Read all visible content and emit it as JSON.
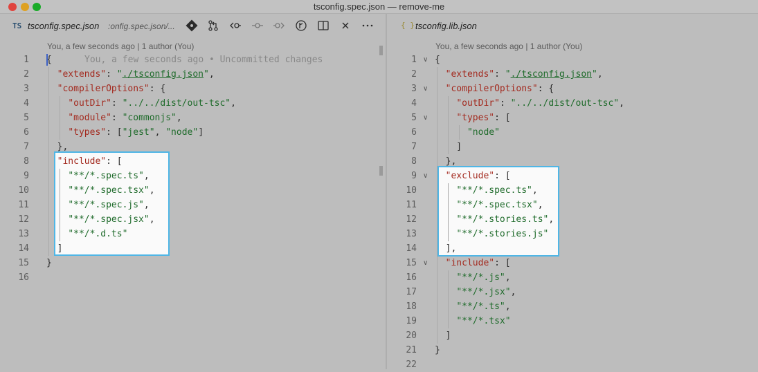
{
  "window": {
    "title": "tsconfig.spec.json — remove-me"
  },
  "left_editor": {
    "tab": {
      "icon_label": "TS",
      "filename": "tsconfig.spec.json",
      "path": ":onfig.spec.json/..."
    },
    "toolbar_icons": [
      "git-commit-icon",
      "pull-request-icon",
      "go-back-icon",
      "commit-node-icon",
      "go-forward-icon",
      "compass-icon",
      "split-editor-icon",
      "close-icon",
      "more-icon"
    ],
    "blame": "You, a few seconds ago | 1 author (You)",
    "inline_blame": "You, a few seconds ago • Uncommitted changes",
    "lines": [
      {
        "n": "1",
        "t": "{"
      },
      {
        "n": "2",
        "t": "  \"extends\": \"./tsconfig.json\","
      },
      {
        "n": "3",
        "t": "  \"compilerOptions\": {"
      },
      {
        "n": "4",
        "t": "    \"outDir\": \"../../dist/out-tsc\","
      },
      {
        "n": "5",
        "t": "    \"module\": \"commonjs\","
      },
      {
        "n": "6",
        "t": "    \"types\": [\"jest\", \"node\"]"
      },
      {
        "n": "7",
        "t": "  },"
      },
      {
        "n": "8",
        "t": "  \"include\": ["
      },
      {
        "n": "9",
        "t": "    \"**/*.spec.ts\","
      },
      {
        "n": "10",
        "t": "    \"**/*.spec.tsx\","
      },
      {
        "n": "11",
        "t": "    \"**/*.spec.js\","
      },
      {
        "n": "12",
        "t": "    \"**/*.spec.jsx\","
      },
      {
        "n": "13",
        "t": "    \"**/*.d.ts\""
      },
      {
        "n": "14",
        "t": "  ]"
      },
      {
        "n": "15",
        "t": "}"
      },
      {
        "n": "16",
        "t": ""
      }
    ]
  },
  "right_editor": {
    "tab": {
      "icon_label": "{ }",
      "filename": "tsconfig.lib.json"
    },
    "blame": "You, a few seconds ago | 1 author (You)",
    "lines": [
      {
        "n": "1",
        "t": "{"
      },
      {
        "n": "2",
        "t": "  \"extends\": \"./tsconfig.json\","
      },
      {
        "n": "3",
        "t": "  \"compilerOptions\": {"
      },
      {
        "n": "4",
        "t": "    \"outDir\": \"../../dist/out-tsc\","
      },
      {
        "n": "5",
        "t": "    \"types\": ["
      },
      {
        "n": "6",
        "t": "      \"node\""
      },
      {
        "n": "7",
        "t": "    ]"
      },
      {
        "n": "8",
        "t": "  },"
      },
      {
        "n": "9",
        "t": "  \"exclude\": ["
      },
      {
        "n": "10",
        "t": "    \"**/*.spec.ts\","
      },
      {
        "n": "11",
        "t": "    \"**/*.spec.tsx\","
      },
      {
        "n": "12",
        "t": "    \"**/*.stories.ts\","
      },
      {
        "n": "13",
        "t": "    \"**/*.stories.js\""
      },
      {
        "n": "14",
        "t": "  ],"
      },
      {
        "n": "15",
        "t": "  \"include\": ["
      },
      {
        "n": "16",
        "t": "    \"**/*.js\","
      },
      {
        "n": "17",
        "t": "    \"**/*.jsx\","
      },
      {
        "n": "18",
        "t": "    \"**/*.ts\","
      },
      {
        "n": "19",
        "t": "    \"**/*.tsx\""
      },
      {
        "n": "20",
        "t": "  ]"
      },
      {
        "n": "21",
        "t": "}"
      },
      {
        "n": "22",
        "t": ""
      }
    ]
  },
  "colors": {
    "key": "#a32a1f",
    "string": "#1f6b2b",
    "highlight_border": "#4fb6e6"
  }
}
